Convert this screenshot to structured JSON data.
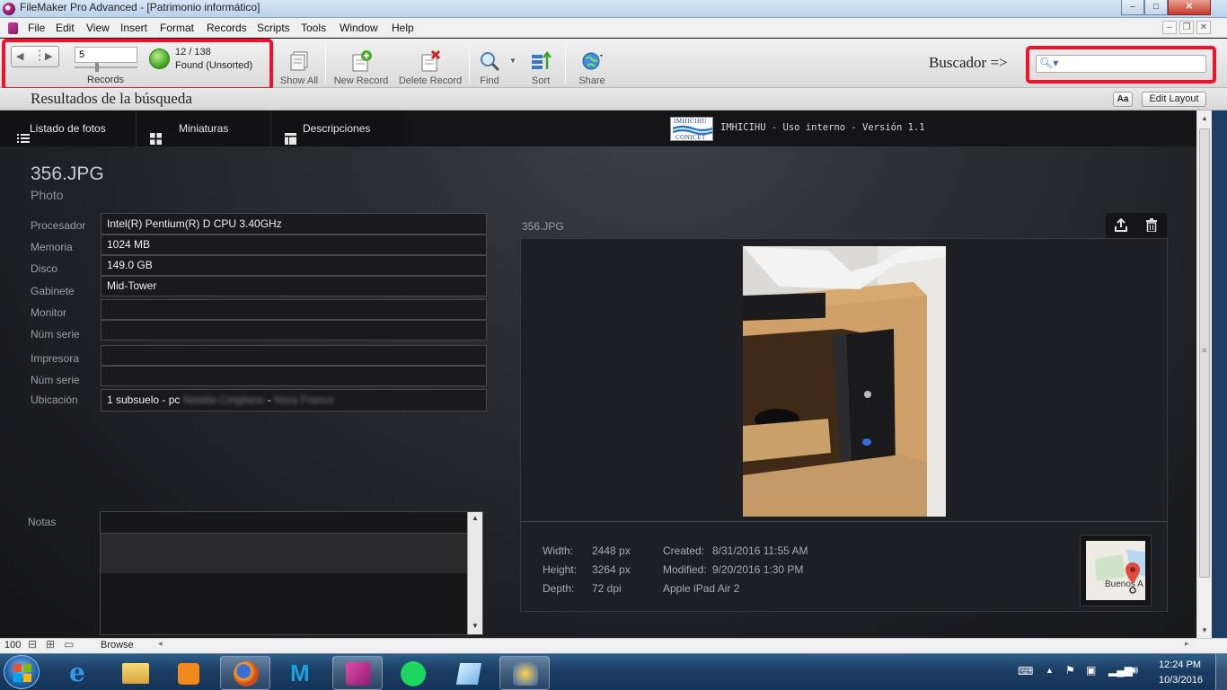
{
  "window": {
    "title": "FileMaker Pro Advanced - [Patrimonio informático]",
    "controls": [
      "minimize",
      "maximize",
      "close"
    ]
  },
  "menubar": {
    "items": [
      "File",
      "Edit",
      "View",
      "Insert",
      "Format",
      "Records",
      "Scripts",
      "Tools",
      "Window",
      "Help"
    ]
  },
  "toolbar": {
    "record_number": "5",
    "records_label": "Records",
    "found_count": "12 / 138",
    "found_status": "Found (Unsorted)",
    "show_all": "Show All",
    "new_record": "New Record",
    "delete_record": "Delete Record",
    "find": "Find",
    "sort": "Sort",
    "share": "Share",
    "search_label": "Buscador =>",
    "search_value": ""
  },
  "layoutbar": {
    "title": "Resultados de la búsqueda",
    "aa_label": "Aa",
    "edit_layout": "Edit Layout"
  },
  "nav": {
    "tabs": [
      "Listado de fotos",
      "Miniaturas",
      "Descripciones"
    ],
    "logo_text": "IMHICIHU",
    "logo_sub": "CONICET",
    "header_text": "IMHICIHU - Uso interno - Versión 1.1"
  },
  "record": {
    "file_name": "356.JPG",
    "file_type": "Photo",
    "fields": [
      {
        "label": "Procesador",
        "value": "Intel(R) Pentium(R) D CPU 3.40GHz"
      },
      {
        "label": "Memoria",
        "value": "1024 MB"
      },
      {
        "label": "Disco",
        "value": "149.0 GB"
      },
      {
        "label": "Gabinete",
        "value": "Mid-Tower"
      },
      {
        "label": "Monitor",
        "value": ""
      },
      {
        "label": "Núm serie",
        "value": ""
      },
      {
        "label": "Impresora",
        "value": ""
      },
      {
        "label": "Núm serie",
        "value": ""
      },
      {
        "label": "Ubicación",
        "value": "1 subsuelo - pc",
        "blurred_1": "Natalia Cirigliano",
        "separator": "-",
        "blurred_2": "Nora Franco"
      }
    ],
    "notes_label": "Notas"
  },
  "photo": {
    "name": "356.JPG",
    "width_label": "Width:",
    "width_value": "2448 px",
    "height_label": "Height:",
    "height_value": "3264 px",
    "depth_label": "Depth:",
    "depth_value": "72 dpi",
    "created_label": "Created:",
    "created_value": "8/31/2016 11:55 AM",
    "modified_label": "Modified:",
    "modified_value": "9/20/2016 1:30 PM",
    "device": "Apple iPad Air 2",
    "map_label": "Buenos A"
  },
  "statusbar": {
    "zoom": "100",
    "mode": "Browse"
  },
  "taskbar": {
    "time": "12:24 PM",
    "date": "10/3/2016"
  },
  "colors": {
    "highlight_red": "#f2102a",
    "content_bg": "#1c1d20",
    "field_bg": "#1a1a1c"
  }
}
